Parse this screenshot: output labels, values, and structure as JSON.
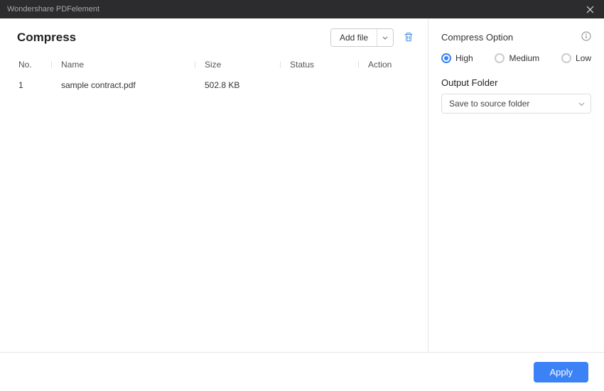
{
  "window": {
    "title": "Wondershare PDFelement"
  },
  "page": {
    "title": "Compress"
  },
  "toolbar": {
    "add_file_label": "Add file"
  },
  "columns": {
    "no": "No.",
    "name": "Name",
    "size": "Size",
    "status": "Status",
    "action": "Action"
  },
  "files": [
    {
      "no": "1",
      "name": "sample contract.pdf",
      "size": "502.8 KB",
      "status": "",
      "action": ""
    }
  ],
  "options": {
    "title": "Compress Option",
    "levels": {
      "high": "High",
      "medium": "Medium",
      "low": "Low"
    },
    "selected": "high",
    "output_folder_label": "Output Folder",
    "output_folder_value": "Save to source folder"
  },
  "footer": {
    "apply_label": "Apply"
  }
}
